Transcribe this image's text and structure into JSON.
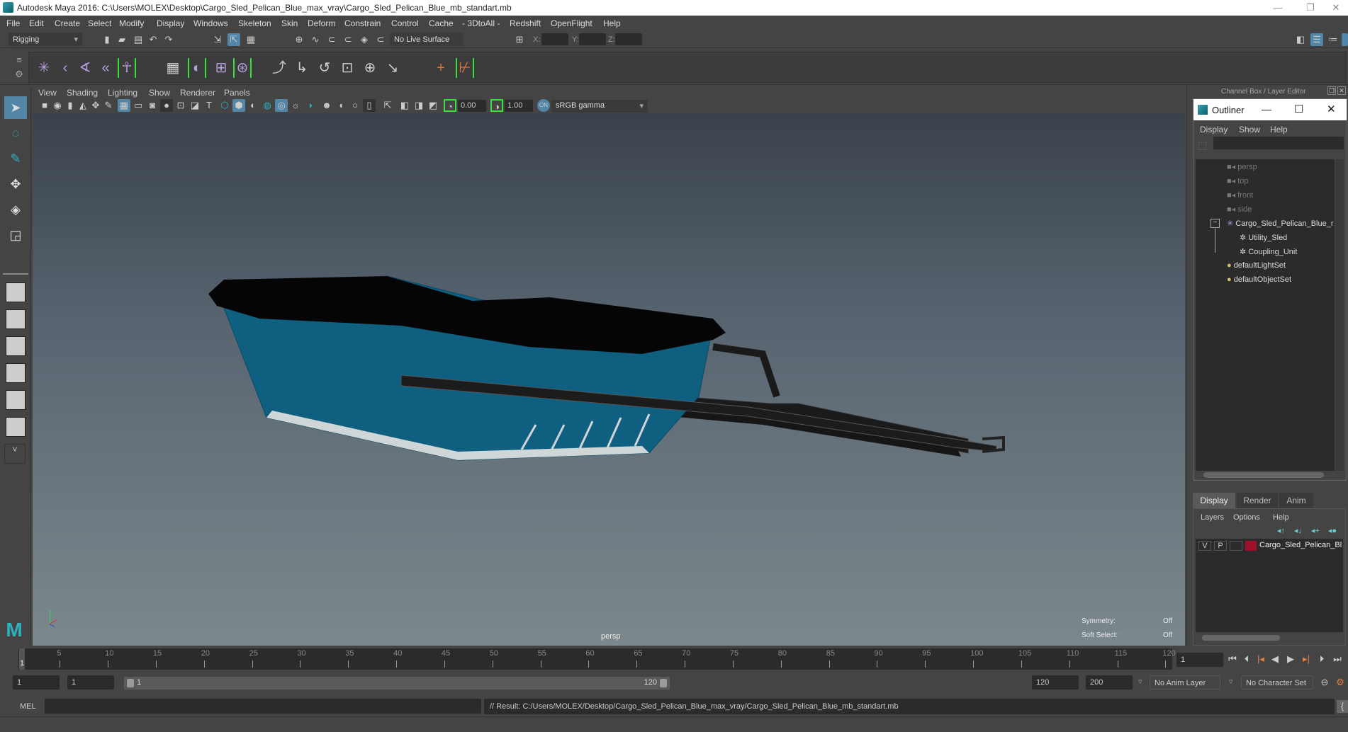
{
  "window": {
    "title": "Autodesk Maya 2016: C:\\Users\\MOLEX\\Desktop\\Cargo_Sled_Pelican_Blue_max_vray\\Cargo_Sled_Pelican_Blue_mb_standart.mb",
    "minimize": "—",
    "restore": "❐",
    "close": "✕"
  },
  "menubar": [
    "File",
    "Edit",
    "Create",
    "Select",
    "Modify",
    "Display",
    "Windows",
    "Skeleton",
    "Skin",
    "Deform",
    "Constrain",
    "Control",
    "Cache",
    "- 3DtoAll -",
    "Redshift",
    "OpenFlight",
    "Help"
  ],
  "statusline": {
    "menuset": "Rigging",
    "live_surface": "No Live Surface",
    "x_label": "X:",
    "y_label": "Y:",
    "z_label": "Z:",
    "x_value": "",
    "y_value": "",
    "z_value": ""
  },
  "panel": {
    "menus": [
      "View",
      "Shading",
      "Lighting",
      "Show",
      "Renderer",
      "Panels"
    ],
    "exposure": "0.00",
    "gamma": "1.00",
    "color_space": "sRGB gamma",
    "camera_label": "persp",
    "symmetry_label": "Symmetry:",
    "symmetry_value": "Off",
    "soft_select_label": "Soft Select:",
    "soft_select_value": "Off"
  },
  "right_panel": {
    "header": "Channel Box / Layer Editor"
  },
  "outliner": {
    "title": "Outliner",
    "menus": [
      "Display",
      "Show",
      "Help"
    ],
    "search": "",
    "items": [
      {
        "label": "persp",
        "type": "camera",
        "dim": true
      },
      {
        "label": "top",
        "type": "camera",
        "dim": true
      },
      {
        "label": "front",
        "type": "camera",
        "dim": true
      },
      {
        "label": "side",
        "type": "camera",
        "dim": true
      },
      {
        "label": "Cargo_Sled_Pelican_Blue_r",
        "type": "joint",
        "expanded": true
      },
      {
        "label": "Utility_Sled",
        "type": "mesh",
        "child": true
      },
      {
        "label": "Coupling_Unit",
        "type": "mesh",
        "child": true
      },
      {
        "label": "defaultLightSet",
        "type": "set"
      },
      {
        "label": "defaultObjectSet",
        "type": "set"
      }
    ]
  },
  "layer_editor": {
    "tabs": [
      "Display",
      "Render",
      "Anim"
    ],
    "active_tab": "Display",
    "menus": [
      "Layers",
      "Options",
      "Help"
    ],
    "layers": [
      {
        "v": "V",
        "p": "P",
        "name": "Cargo_Sled_Pelican_Bl",
        "color": "#a0102a"
      }
    ]
  },
  "timeline": {
    "ticks": [
      5,
      10,
      15,
      20,
      25,
      30,
      35,
      40,
      45,
      50,
      55,
      60,
      65,
      70,
      75,
      80,
      85,
      90,
      95,
      100,
      105,
      110,
      115,
      120
    ],
    "current": "1",
    "current_frame_field": "1"
  },
  "range": {
    "start": "1",
    "playback_start": "1",
    "slider_start": "1",
    "slider_end": "120",
    "playback_end": "120",
    "end": "200",
    "anim_layer": "No Anim Layer",
    "character_set": "No Character Set"
  },
  "command": {
    "language": "MEL",
    "input": "",
    "result": "// Result: C:/Users/MOLEX/Desktop/Cargo_Sled_Pelican_Blue_max_vray/Cargo_Sled_Pelican_Blue_mb_standart.mb"
  },
  "colors": {
    "accent": "#5285a6",
    "maya_teal": "#2fb0bf",
    "sled_blue": "#0f5f80",
    "layer_red": "#a0102a"
  }
}
